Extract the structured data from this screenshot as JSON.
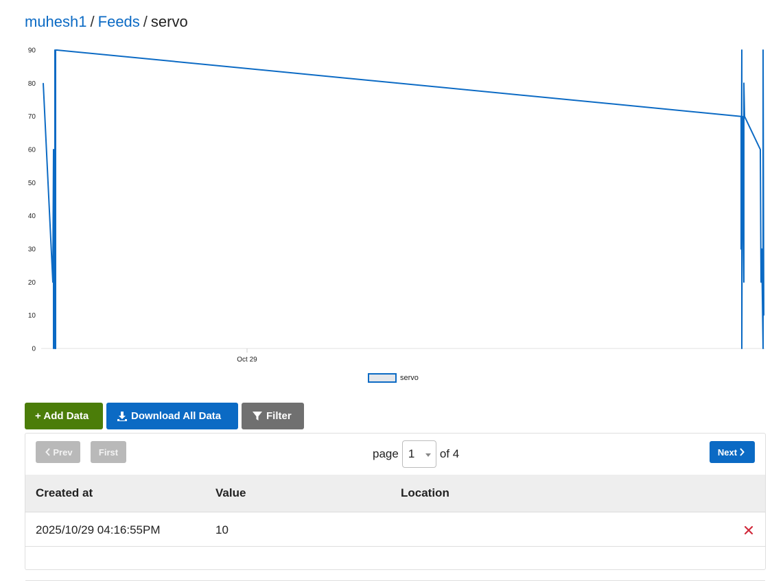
{
  "breadcrumb": {
    "user": "muhesh1",
    "feeds": "Feeds",
    "feed": "servo",
    "separator": "/"
  },
  "chart_data": {
    "type": "line",
    "ylim": [
      0,
      90
    ],
    "yticks": [
      0,
      10,
      20,
      30,
      40,
      50,
      60,
      70,
      80,
      90
    ],
    "xtick_labels": [
      "Oct 29"
    ],
    "legend": "servo",
    "grid": false,
    "series": [
      {
        "name": "servo",
        "color": "#0b6ac4",
        "values": [
          80,
          20,
          60,
          0,
          40,
          0,
          90,
          0,
          90,
          90,
          70,
          30,
          90,
          0,
          70,
          20,
          80,
          70,
          60,
          20,
          30,
          0,
          90,
          10
        ]
      }
    ]
  },
  "toolbar": {
    "add": "+ Add Data",
    "download": "Download All Data",
    "filter": "Filter"
  },
  "pager": {
    "prev": "Prev",
    "first": "First",
    "next": "Next",
    "page_label": "page",
    "current": "1",
    "of_label": "of 4"
  },
  "table": {
    "headers": [
      "Created at",
      "Value",
      "Location"
    ],
    "rows": [
      {
        "created_at": "2025/10/29 04:16:55PM",
        "value": "10",
        "location": ""
      }
    ]
  },
  "colors": {
    "link": "#0b6ac4",
    "add_button": "#4b7d09",
    "download_button": "#0b6ac4",
    "filter_button": "#707070",
    "delete_icon": "#d12a3b"
  }
}
